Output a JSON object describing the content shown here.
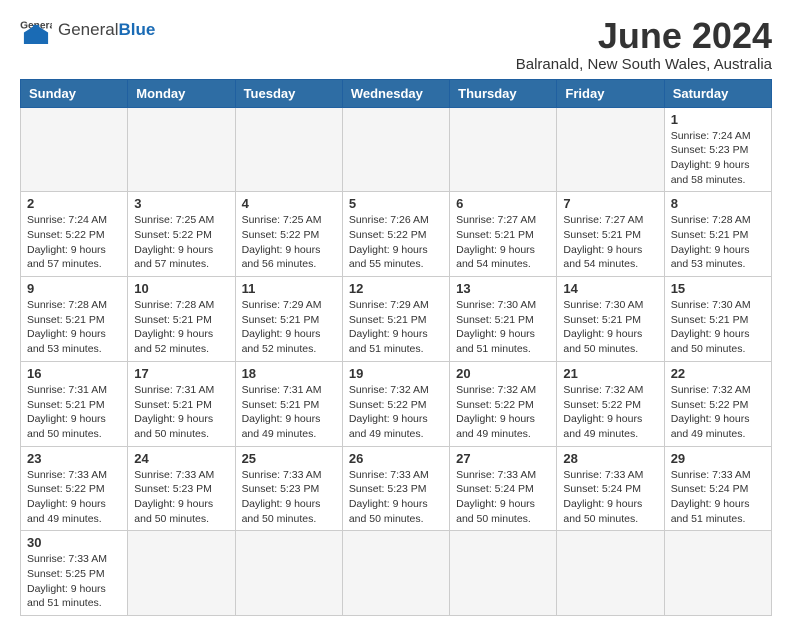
{
  "header": {
    "logo_general": "General",
    "logo_blue": "Blue",
    "month_title": "June 2024",
    "subtitle": "Balranald, New South Wales, Australia"
  },
  "days_of_week": [
    "Sunday",
    "Monday",
    "Tuesday",
    "Wednesday",
    "Thursday",
    "Friday",
    "Saturday"
  ],
  "weeks": [
    [
      null,
      null,
      null,
      null,
      null,
      null,
      {
        "day": 1,
        "sunrise": "7:24 AM",
        "sunset": "5:23 PM",
        "daylight_h": 9,
        "daylight_m": 58
      }
    ],
    [
      {
        "day": 2,
        "sunrise": "7:24 AM",
        "sunset": "5:22 PM",
        "daylight_h": 9,
        "daylight_m": 57
      },
      {
        "day": 3,
        "sunrise": "7:25 AM",
        "sunset": "5:22 PM",
        "daylight_h": 9,
        "daylight_m": 57
      },
      {
        "day": 4,
        "sunrise": "7:25 AM",
        "sunset": "5:22 PM",
        "daylight_h": 9,
        "daylight_m": 56
      },
      {
        "day": 5,
        "sunrise": "7:26 AM",
        "sunset": "5:22 PM",
        "daylight_h": 9,
        "daylight_m": 55
      },
      {
        "day": 6,
        "sunrise": "7:27 AM",
        "sunset": "5:21 PM",
        "daylight_h": 9,
        "daylight_m": 54
      },
      {
        "day": 7,
        "sunrise": "7:27 AM",
        "sunset": "5:21 PM",
        "daylight_h": 9,
        "daylight_m": 54
      },
      {
        "day": 8,
        "sunrise": "7:28 AM",
        "sunset": "5:21 PM",
        "daylight_h": 9,
        "daylight_m": 53
      }
    ],
    [
      {
        "day": 9,
        "sunrise": "7:28 AM",
        "sunset": "5:21 PM",
        "daylight_h": 9,
        "daylight_m": 53
      },
      {
        "day": 10,
        "sunrise": "7:28 AM",
        "sunset": "5:21 PM",
        "daylight_h": 9,
        "daylight_m": 52
      },
      {
        "day": 11,
        "sunrise": "7:29 AM",
        "sunset": "5:21 PM",
        "daylight_h": 9,
        "daylight_m": 52
      },
      {
        "day": 12,
        "sunrise": "7:29 AM",
        "sunset": "5:21 PM",
        "daylight_h": 9,
        "daylight_m": 51
      },
      {
        "day": 13,
        "sunrise": "7:30 AM",
        "sunset": "5:21 PM",
        "daylight_h": 9,
        "daylight_m": 51
      },
      {
        "day": 14,
        "sunrise": "7:30 AM",
        "sunset": "5:21 PM",
        "daylight_h": 9,
        "daylight_m": 50
      },
      {
        "day": 15,
        "sunrise": "7:30 AM",
        "sunset": "5:21 PM",
        "daylight_h": 9,
        "daylight_m": 50
      }
    ],
    [
      {
        "day": 16,
        "sunrise": "7:31 AM",
        "sunset": "5:21 PM",
        "daylight_h": 9,
        "daylight_m": 50
      },
      {
        "day": 17,
        "sunrise": "7:31 AM",
        "sunset": "5:21 PM",
        "daylight_h": 9,
        "daylight_m": 50
      },
      {
        "day": 18,
        "sunrise": "7:31 AM",
        "sunset": "5:21 PM",
        "daylight_h": 9,
        "daylight_m": 49
      },
      {
        "day": 19,
        "sunrise": "7:32 AM",
        "sunset": "5:22 PM",
        "daylight_h": 9,
        "daylight_m": 49
      },
      {
        "day": 20,
        "sunrise": "7:32 AM",
        "sunset": "5:22 PM",
        "daylight_h": 9,
        "daylight_m": 49
      },
      {
        "day": 21,
        "sunrise": "7:32 AM",
        "sunset": "5:22 PM",
        "daylight_h": 9,
        "daylight_m": 49
      },
      {
        "day": 22,
        "sunrise": "7:32 AM",
        "sunset": "5:22 PM",
        "daylight_h": 9,
        "daylight_m": 49
      }
    ],
    [
      {
        "day": 23,
        "sunrise": "7:33 AM",
        "sunset": "5:22 PM",
        "daylight_h": 9,
        "daylight_m": 49
      },
      {
        "day": 24,
        "sunrise": "7:33 AM",
        "sunset": "5:23 PM",
        "daylight_h": 9,
        "daylight_m": 50
      },
      {
        "day": 25,
        "sunrise": "7:33 AM",
        "sunset": "5:23 PM",
        "daylight_h": 9,
        "daylight_m": 50
      },
      {
        "day": 26,
        "sunrise": "7:33 AM",
        "sunset": "5:23 PM",
        "daylight_h": 9,
        "daylight_m": 50
      },
      {
        "day": 27,
        "sunrise": "7:33 AM",
        "sunset": "5:24 PM",
        "daylight_h": 9,
        "daylight_m": 50
      },
      {
        "day": 28,
        "sunrise": "7:33 AM",
        "sunset": "5:24 PM",
        "daylight_h": 9,
        "daylight_m": 50
      },
      {
        "day": 29,
        "sunrise": "7:33 AM",
        "sunset": "5:24 PM",
        "daylight_h": 9,
        "daylight_m": 51
      }
    ],
    [
      {
        "day": 30,
        "sunrise": "7:33 AM",
        "sunset": "5:25 PM",
        "daylight_h": 9,
        "daylight_m": 51
      },
      null,
      null,
      null,
      null,
      null,
      null
    ]
  ]
}
